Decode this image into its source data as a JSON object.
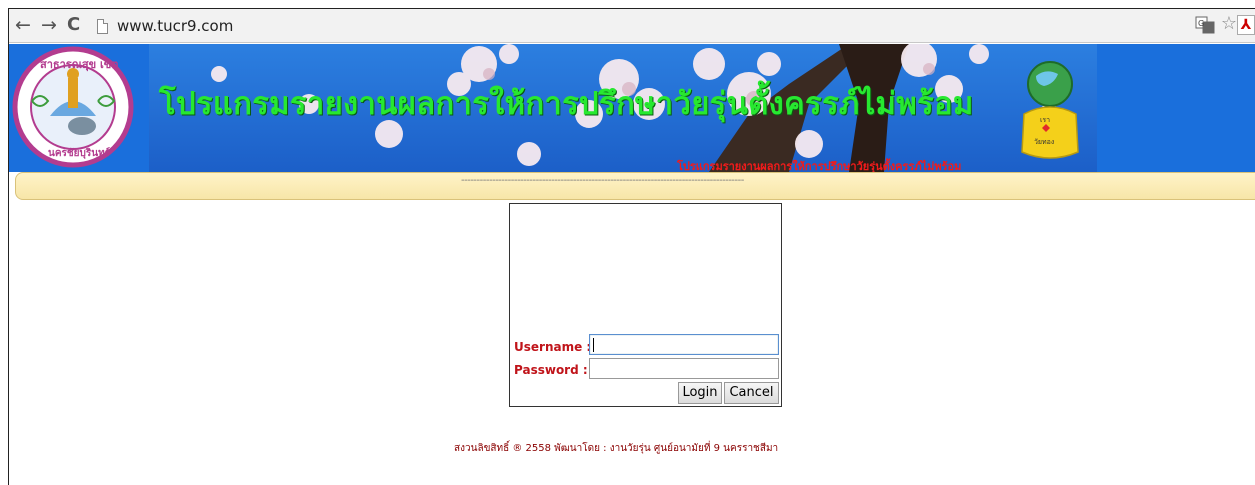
{
  "browser": {
    "back_icon": "←",
    "forward_icon": "→",
    "reload_icon": "C",
    "url": "www.tucr9.com"
  },
  "banner": {
    "title": "โปรแกรมรายงานผลการให้การปรึกษาวัยรุ่นตั้งครรภ์ไม่พร้อม",
    "subtitle": "โปรแกรมรายงานผลการให้การปรึกษาวัยรุ่นตั้งครรภ์ไม่พร้อม",
    "colors": {
      "background": "#1a6fdc",
      "title": "#27e830",
      "subtitle": "#f21b1b"
    }
  },
  "menubar": {
    "separator": "-------------------------------------------------------------------------------------------"
  },
  "login": {
    "username_label": "Username :",
    "password_label": "Password :",
    "username_value": "",
    "password_value": "",
    "login_label": "Login",
    "cancel_label": "Cancel"
  },
  "footer": {
    "text": "สงวนลิขสิทธิ์ ® 2558 พัฒนาโดย : งานวัยรุ่น ศูนย์อนามัยที่ 9 นครราชสีมา"
  }
}
